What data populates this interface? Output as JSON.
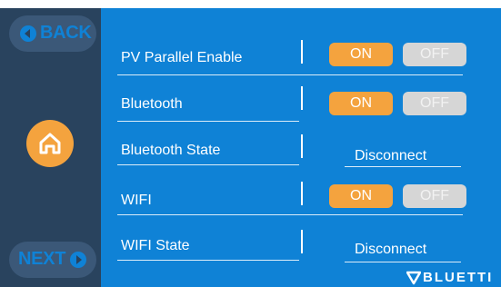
{
  "nav": {
    "back_label": "BACK",
    "next_label": "NEXT",
    "home_icon": "home-icon"
  },
  "settings": [
    {
      "label": "PV Parallel Enable",
      "type": "toggle",
      "on_label": "ON",
      "off_label": "OFF",
      "selected": "ON"
    },
    {
      "label": "Bluetooth",
      "type": "toggle",
      "on_label": "ON",
      "off_label": "OFF",
      "selected": "ON"
    },
    {
      "label": "Bluetooth State",
      "type": "status",
      "value": "Disconnect"
    },
    {
      "label": "WIFI",
      "type": "toggle",
      "on_label": "ON",
      "off_label": "OFF",
      "selected": "ON"
    },
    {
      "label": "WIFI State",
      "type": "status",
      "value": "Disconnect"
    }
  ],
  "brand": {
    "name": "BLUETTI"
  },
  "colors": {
    "background": "#0f82d6",
    "sidebar": "#29435e",
    "accent": "#f4a33e",
    "off_button": "#d6d6d6"
  }
}
